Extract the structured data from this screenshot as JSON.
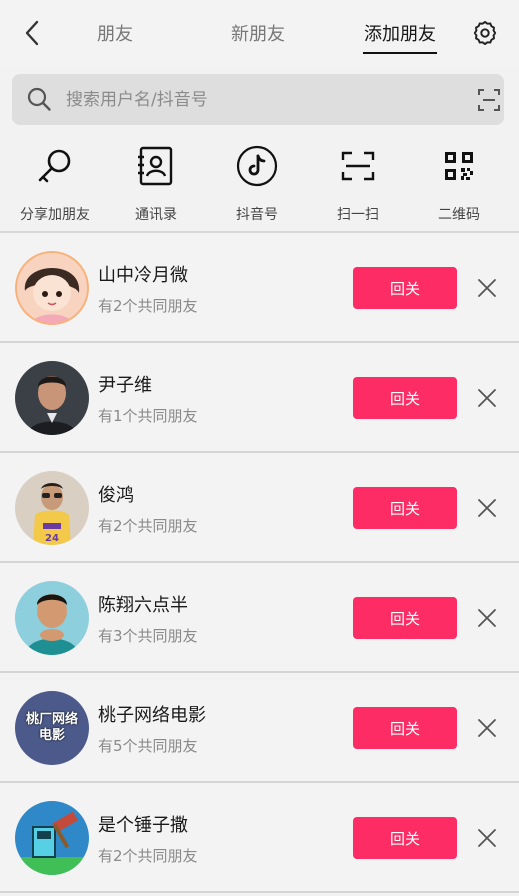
{
  "header": {
    "tabs": [
      {
        "label": "朋友",
        "active": false
      },
      {
        "label": "新朋友",
        "active": false
      },
      {
        "label": "添加朋友",
        "active": true
      }
    ],
    "back_icon": "chevron-left-icon",
    "settings_icon": "gear-icon"
  },
  "search": {
    "placeholder": "搜索用户名/抖音号",
    "value": "",
    "search_icon": "search-icon",
    "scan_icon": "scan-icon"
  },
  "quick_actions": [
    {
      "label": "分享加朋友",
      "icon": "share-key-icon"
    },
    {
      "label": "通讯录",
      "icon": "contacts-icon"
    },
    {
      "label": "抖音号",
      "icon": "tiktok-icon"
    },
    {
      "label": "扫一扫",
      "icon": "scan-icon"
    },
    {
      "label": "二维码",
      "icon": "qrcode-icon"
    }
  ],
  "suggestions": [
    {
      "name": "山中冷月微",
      "mutual": "有2个共同朋友",
      "action": "回关",
      "avatar_color": "#f6c6a8"
    },
    {
      "name": "尹子维",
      "mutual": "有1个共同朋友",
      "action": "回关",
      "avatar_color": "#2f3438"
    },
    {
      "name": "俊鸿",
      "mutual": "有2个共同朋友",
      "action": "回关",
      "avatar_color": "#c7a15b"
    },
    {
      "name": "陈翔六点半",
      "mutual": "有3个共同朋友",
      "action": "回关",
      "avatar_color": "#5fb7c9"
    },
    {
      "name": "桃子网络电影",
      "mutual": "有5个共同朋友",
      "action": "回关",
      "avatar_color": "#4b5a8a",
      "avatar_text": "桃厂网络电影"
    },
    {
      "name": "是个锤子撒",
      "mutual": "有2个共同朋友",
      "action": "回关",
      "avatar_color": "#2f89c8"
    }
  ],
  "colors": {
    "accent": "#fe2c64",
    "background": "#f2f2f2",
    "search_bg": "#dedede"
  }
}
